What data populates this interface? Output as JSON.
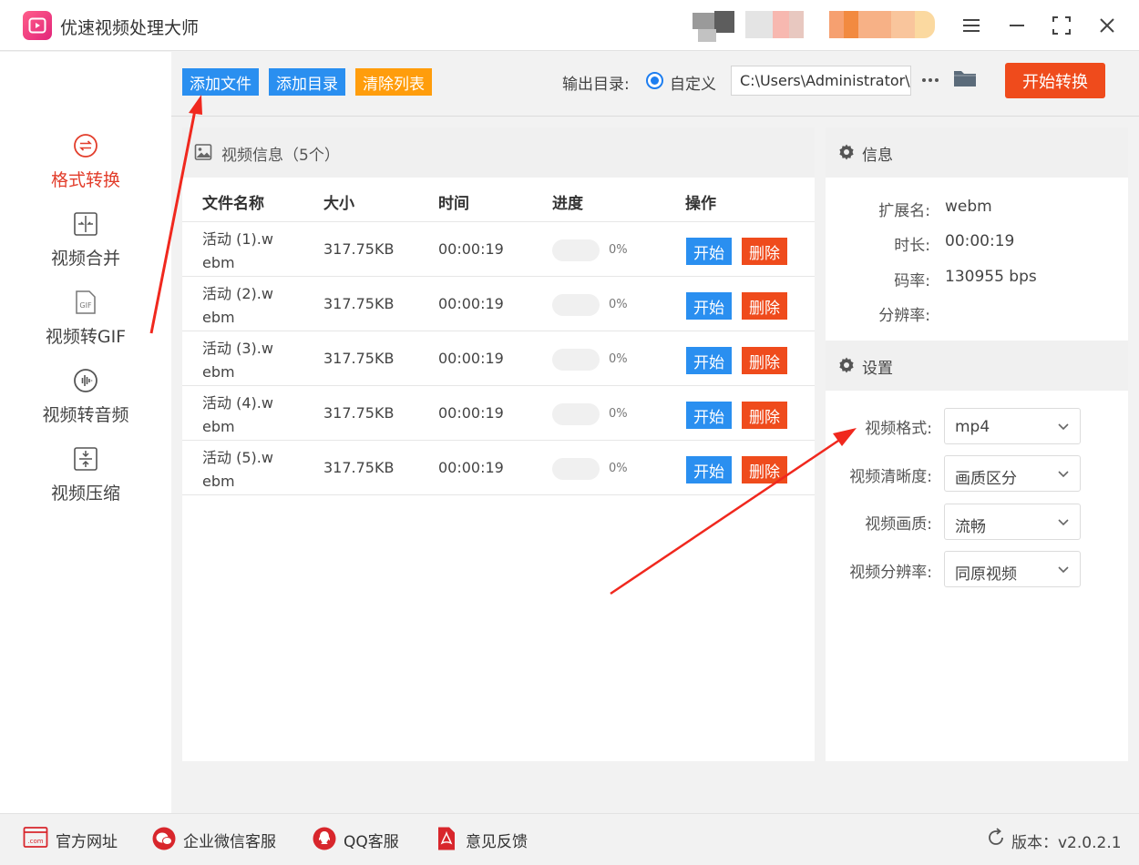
{
  "app": {
    "title": "优速视频处理大师"
  },
  "window_controls": {
    "menu": "menu-icon",
    "minimize": "minimize-icon",
    "maximize": "maximize-icon",
    "close": "close-icon"
  },
  "sidebar": {
    "items": [
      {
        "label": "格式转换",
        "icon": "format-convert-icon",
        "active": true
      },
      {
        "label": "视频合并",
        "icon": "merge-icon",
        "active": false
      },
      {
        "label": "视频转GIF",
        "icon": "gif-icon",
        "active": false
      },
      {
        "label": "视频转音频",
        "icon": "audio-icon",
        "active": false
      },
      {
        "label": "视频压缩",
        "icon": "compress-icon",
        "active": false
      }
    ]
  },
  "toolbar": {
    "add_file": "添加文件",
    "add_dir": "添加目录",
    "clear_list": "清除列表",
    "output_label": "输出目录:",
    "radio_label": "自定义",
    "output_path": "C:\\Users\\Administrator\\",
    "more": "•••",
    "start": "开始转换"
  },
  "video_panel": {
    "header": "视频信息（5个）",
    "columns": {
      "name": "文件名称",
      "size": "大小",
      "time": "时间",
      "progress": "进度",
      "actions": "操作"
    },
    "rows": [
      {
        "name_line1": "活动 (1).w",
        "name_line2": "ebm",
        "size": "317.75KB",
        "time": "00:00:19",
        "progress": 0,
        "progress_text": "0%",
        "start": "开始",
        "delete": "删除"
      },
      {
        "name_line1": "活动 (2).w",
        "name_line2": "ebm",
        "size": "317.75KB",
        "time": "00:00:19",
        "progress": 0,
        "progress_text": "0%",
        "start": "开始",
        "delete": "删除"
      },
      {
        "name_line1": "活动 (3).w",
        "name_line2": "ebm",
        "size": "317.75KB",
        "time": "00:00:19",
        "progress": 0,
        "progress_text": "0%",
        "start": "开始",
        "delete": "删除"
      },
      {
        "name_line1": "活动 (4).w",
        "name_line2": "ebm",
        "size": "317.75KB",
        "time": "00:00:19",
        "progress": 0,
        "progress_text": "0%",
        "start": "开始",
        "delete": "删除"
      },
      {
        "name_line1": "活动 (5).w",
        "name_line2": "ebm",
        "size": "317.75KB",
        "time": "00:00:19",
        "progress": 0,
        "progress_text": "0%",
        "start": "开始",
        "delete": "删除"
      }
    ]
  },
  "info_panel": {
    "header": "信息",
    "fields": [
      {
        "key": "扩展名:",
        "value": "webm"
      },
      {
        "key": "时长:",
        "value": "00:00:19"
      },
      {
        "key": "码率:",
        "value": "130955 bps"
      },
      {
        "key": "分辨率:",
        "value": ""
      }
    ]
  },
  "settings_panel": {
    "header": "设置",
    "fields": [
      {
        "key": "视频格式:",
        "value": "mp4"
      },
      {
        "key": "视频清晰度:",
        "value": "画质区分"
      },
      {
        "key": "视频画质:",
        "value": "流畅"
      },
      {
        "key": "视频分辨率:",
        "value": "同原视频"
      }
    ]
  },
  "footer": {
    "links": [
      {
        "label": "官方网址",
        "icon": "website-icon"
      },
      {
        "label": "企业微信客服",
        "icon": "wechat-icon"
      },
      {
        "label": "QQ客服",
        "icon": "qq-icon"
      },
      {
        "label": "意见反馈",
        "icon": "feedback-icon"
      }
    ],
    "version": "版本：v2.0.2.1",
    "version_icon": "refresh-icon"
  },
  "colors": {
    "accent_blue": "#2a8ff0",
    "accent_orange": "#ff9d0c",
    "start_red": "#ef4b1c",
    "active_red": "#e23d2b",
    "arrow_red": "#f0281e"
  }
}
